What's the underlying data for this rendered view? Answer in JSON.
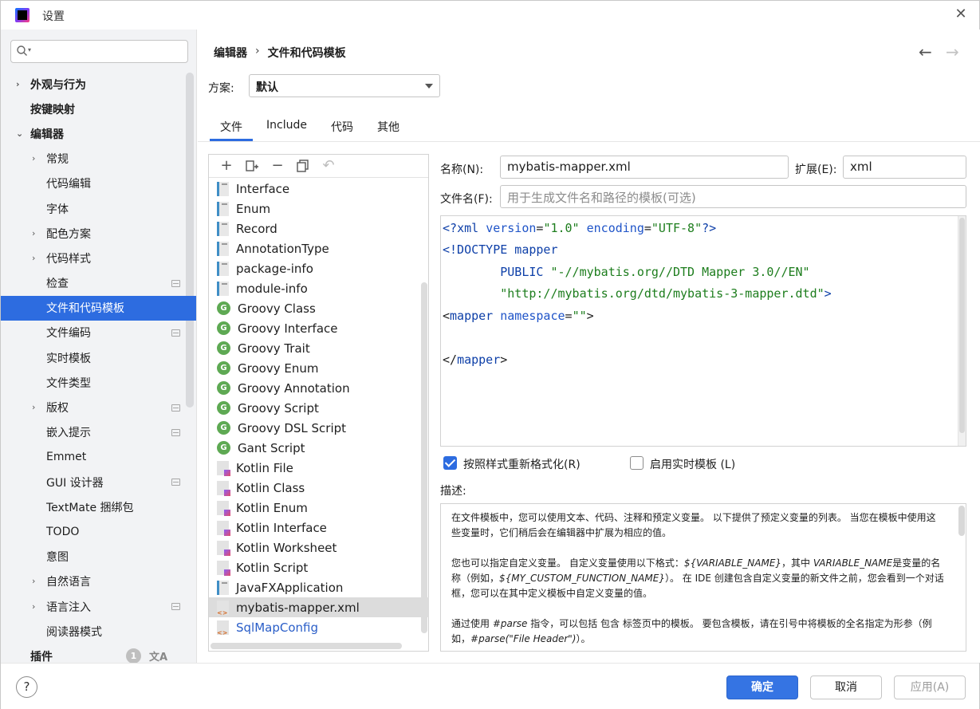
{
  "window": {
    "title": "设置"
  },
  "sidebar": {
    "search_placeholder": "",
    "items": [
      {
        "label": "外观与行为",
        "chevron": "›",
        "bold": true
      },
      {
        "label": "按键映射",
        "chevron": "",
        "bold": true
      },
      {
        "label": "编辑器",
        "chevron": "⌄",
        "bold": true
      },
      {
        "label": "常规",
        "chevron": "›"
      },
      {
        "label": "代码编辑",
        "chevron": ""
      },
      {
        "label": "字体",
        "chevron": ""
      },
      {
        "label": "配色方案",
        "chevron": "›"
      },
      {
        "label": "代码样式",
        "chevron": "›"
      },
      {
        "label": "检查",
        "chevron": ""
      },
      {
        "label": "文件和代码模板",
        "chevron": "",
        "selected": true
      },
      {
        "label": "文件编码",
        "chevron": ""
      },
      {
        "label": "实时模板",
        "chevron": ""
      },
      {
        "label": "文件类型",
        "chevron": ""
      },
      {
        "label": "版权",
        "chevron": "›"
      },
      {
        "label": "嵌入提示",
        "chevron": ""
      },
      {
        "label": "Emmet",
        "chevron": ""
      },
      {
        "label": "GUI 设计器",
        "chevron": ""
      },
      {
        "label": "TextMate 捆绑包",
        "chevron": ""
      },
      {
        "label": "TODO",
        "chevron": ""
      },
      {
        "label": "意图",
        "chevron": ""
      },
      {
        "label": "自然语言",
        "chevron": "›"
      },
      {
        "label": "语言注入",
        "chevron": "›"
      },
      {
        "label": "阅读器模式",
        "chevron": ""
      },
      {
        "label": "插件",
        "chevron": "",
        "bold": true,
        "badge": "1"
      }
    ]
  },
  "main": {
    "breadcrumb": [
      "编辑器",
      "›",
      "文件和代码模板"
    ],
    "scheme_label": "方案:",
    "scheme_value": "默认",
    "tabs": [
      "文件",
      "Include",
      "代码",
      "其他"
    ],
    "active_tab": "文件"
  },
  "templates": [
    {
      "label": "Interface",
      "icon": "java-file-icon"
    },
    {
      "label": "Enum",
      "icon": "java-file-icon"
    },
    {
      "label": "Record",
      "icon": "java-file-icon"
    },
    {
      "label": "AnnotationType",
      "icon": "java-file-icon"
    },
    {
      "label": "package-info",
      "icon": "java-file-icon"
    },
    {
      "label": "module-info",
      "icon": "java-file-icon"
    },
    {
      "label": "Groovy Class",
      "icon": "groovy-icon"
    },
    {
      "label": "Groovy Interface",
      "icon": "groovy-icon"
    },
    {
      "label": "Groovy Trait",
      "icon": "groovy-icon"
    },
    {
      "label": "Groovy Enum",
      "icon": "groovy-icon"
    },
    {
      "label": "Groovy Annotation",
      "icon": "groovy-icon"
    },
    {
      "label": "Groovy Script",
      "icon": "groovy-icon"
    },
    {
      "label": "Groovy DSL Script",
      "icon": "groovy-icon"
    },
    {
      "label": "Gant Script",
      "icon": "groovy-icon"
    },
    {
      "label": "Kotlin File",
      "icon": "kotlin-file-icon"
    },
    {
      "label": "Kotlin Class",
      "icon": "kotlin-file-icon"
    },
    {
      "label": "Kotlin Enum",
      "icon": "kotlin-file-icon"
    },
    {
      "label": "Kotlin Interface",
      "icon": "kotlin-file-icon"
    },
    {
      "label": "Kotlin Worksheet",
      "icon": "kotlin-file-icon"
    },
    {
      "label": "Kotlin Script",
      "icon": "kotlin-file-icon"
    },
    {
      "label": "JavaFXApplication",
      "icon": "java-file-icon"
    },
    {
      "label": "mybatis-mapper.xml",
      "icon": "xml-file-icon",
      "selected": true
    },
    {
      "label": "SqlMapConfig",
      "icon": "xml-file-icon",
      "link": true
    }
  ],
  "editor": {
    "name_label": "名称(N):",
    "name_value": "mybatis-mapper.xml",
    "ext_label": "扩展(E):",
    "ext_value": "xml",
    "filename_label": "文件名(F):",
    "filename_placeholder": "用于生成文件名和路径的模板(可选)",
    "code_lines": [
      "<?xml version=\"1.0\" encoding=\"UTF-8\"?>",
      "<!DOCTYPE mapper",
      "        PUBLIC \"-//mybatis.org//DTD Mapper 3.0//EN\"",
      "        \"http://mybatis.org/dtd/mybatis-3-mapper.dtd\">",
      "<mapper namespace=\"\">",
      "",
      "</mapper>"
    ],
    "reformat_label": "按照样式重新格式化(R)",
    "reformat_checked": true,
    "live_template_label": "启用实时模板 (L)",
    "live_template_checked": false,
    "description_label": "描述:",
    "description_p1": "在文件模板中，您可以使用文本、代码、注释和预定义变量。 以下提供了预定义变量的列表。 当您在模板中使用这些变量时，它们稍后会在编辑器中扩展为相应的值。",
    "description_p2_a": "您也可以指定自定义变量。 自定义变量使用以下格式：",
    "description_p2_var1": "${VARIABLE_NAME}",
    "description_p2_b": "，其中 ",
    "description_p2_var2": "VARIABLE_NAME",
    "description_p2_c": "是变量的名称（例如，",
    "description_p2_var3": "${MY_CUSTOM_FUNCTION_NAME}",
    "description_p2_d": "）。 在 IDE 创建包含自定义变量的新文件之前，您会看到一个对话框，您可以在其中定义模板中自定义变量的值。",
    "description_p3_a": "通过使用 ",
    "description_p3_var1": "#parse",
    "description_p3_b": " 指令，可以包括 包含 标签页中的模板。 要包含模板，请在引号中将模板的全名指定为形参（例如，",
    "description_p3_var2": "#parse(\"File Header\")",
    "description_p3_c": "）。"
  },
  "footer": {
    "help": "?",
    "ok": "确定",
    "cancel": "取消",
    "apply": "应用(A)"
  },
  "colors": {
    "accent": "#2d6ce0",
    "primary_button": "#3574e3"
  }
}
